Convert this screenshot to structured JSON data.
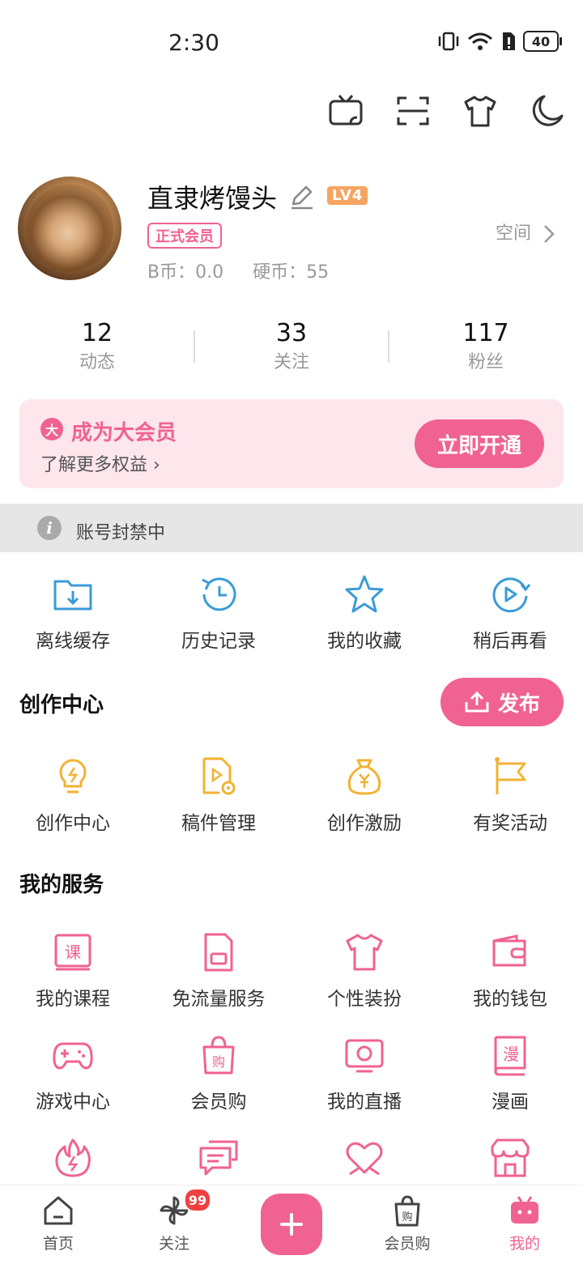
{
  "status_bar": {
    "time": "2:30",
    "battery": "40"
  },
  "profile": {
    "username": "直隶烤馒头",
    "level": "LV4",
    "member_tag": "正式会员",
    "bcoins": "B币：0.0",
    "coins": "硬币：55",
    "space_link": "空间"
  },
  "stats": [
    {
      "value": "12",
      "label": "动态"
    },
    {
      "value": "33",
      "label": "关注"
    },
    {
      "value": "117",
      "label": "粉丝"
    }
  ],
  "vip": {
    "icon_text": "大",
    "title": "成为大会员",
    "subtitle": "了解更多权益 ›",
    "button": "立即开通"
  },
  "ban_notice": "账号封禁中",
  "quick_actions": [
    {
      "label": "离线缓存",
      "icon": "download-folder-icon"
    },
    {
      "label": "历史记录",
      "icon": "history-clock-icon"
    },
    {
      "label": "我的收藏",
      "icon": "star-icon"
    },
    {
      "label": "稍后再看",
      "icon": "watch-later-icon"
    }
  ],
  "creator": {
    "title": "创作中心",
    "publish_button": "发布",
    "items": [
      {
        "label": "创作中心",
        "icon": "lightbulb-icon"
      },
      {
        "label": "稿件管理",
        "icon": "manuscript-icon"
      },
      {
        "label": "创作激励",
        "icon": "money-bag-icon"
      },
      {
        "label": "有奖活动",
        "icon": "flag-icon"
      }
    ]
  },
  "services": {
    "title": "我的服务",
    "rows": [
      [
        {
          "label": "我的课程",
          "icon": "course-icon"
        },
        {
          "label": "免流量服务",
          "icon": "sim-card-icon"
        },
        {
          "label": "个性装扮",
          "icon": "tshirt-icon"
        },
        {
          "label": "我的钱包",
          "icon": "wallet-icon"
        }
      ],
      [
        {
          "label": "游戏中心",
          "icon": "gamepad-icon"
        },
        {
          "label": "会员购",
          "icon": "shopping-bag-icon"
        },
        {
          "label": "我的直播",
          "icon": "live-tv-icon"
        },
        {
          "label": "漫画",
          "icon": "comic-book-icon"
        }
      ],
      [
        {
          "label": "",
          "icon": "flame-icon"
        },
        {
          "label": "",
          "icon": "chat-bubbles-icon"
        },
        {
          "label": "",
          "icon": "heart-icon"
        },
        {
          "label": "",
          "icon": "store-icon"
        }
      ]
    ]
  },
  "bottom_nav": [
    {
      "label": "首页",
      "icon": "home-icon"
    },
    {
      "label": "关注",
      "icon": "pinwheel-icon",
      "badge": "99"
    },
    {
      "label": "会员购",
      "icon": "shopping-bag-icon"
    },
    {
      "label": "我的",
      "icon": "tv-mascot-icon",
      "active": true
    }
  ],
  "colors": {
    "accent": "#f06292",
    "creator_icon": "#f2b233",
    "quick_icon": "#3a9bd8"
  }
}
